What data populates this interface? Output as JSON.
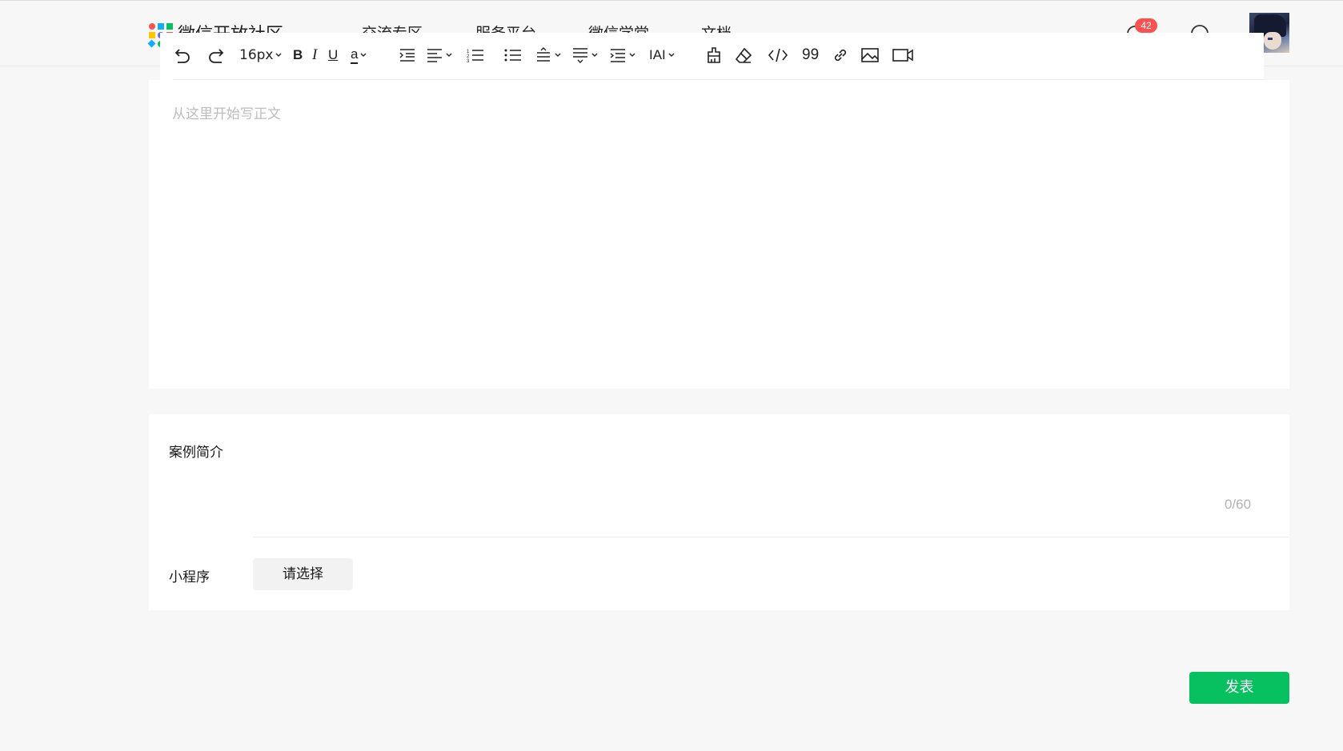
{
  "header": {
    "site_name": "微信开放社区",
    "nav": [
      "交流专区",
      "服务平台",
      "微信学堂",
      "文档"
    ],
    "notification_count": "42",
    "logo_colors": [
      "#fa5151",
      "#10aeff",
      "#07c160",
      "#ffc300",
      "#6467f0"
    ]
  },
  "toolbar": {
    "font_size": "16px",
    "bold": "B",
    "italic": "I",
    "underline": "U",
    "font_color": "a",
    "letter_spacing": "IAI",
    "quote": "99",
    "icons": [
      "undo-icon",
      "redo-icon",
      "indent-icon",
      "align-icon",
      "ordered-list-icon",
      "bullet-list-icon",
      "line-height-icon",
      "paragraph-spacing-icon",
      "list-style-icon",
      "format-painter-icon",
      "eraser-icon",
      "code-icon",
      "quote-icon",
      "link-icon",
      "image-icon",
      "video-icon"
    ]
  },
  "editor": {
    "placeholder": "从这里开始写正文"
  },
  "form": {
    "summary_label": "案例简介",
    "summary_counter": "0/60",
    "miniprogram_label": "小程序",
    "select_label": "请选择"
  },
  "actions": {
    "publish_label": "发表",
    "publish_color": "#07c160"
  }
}
